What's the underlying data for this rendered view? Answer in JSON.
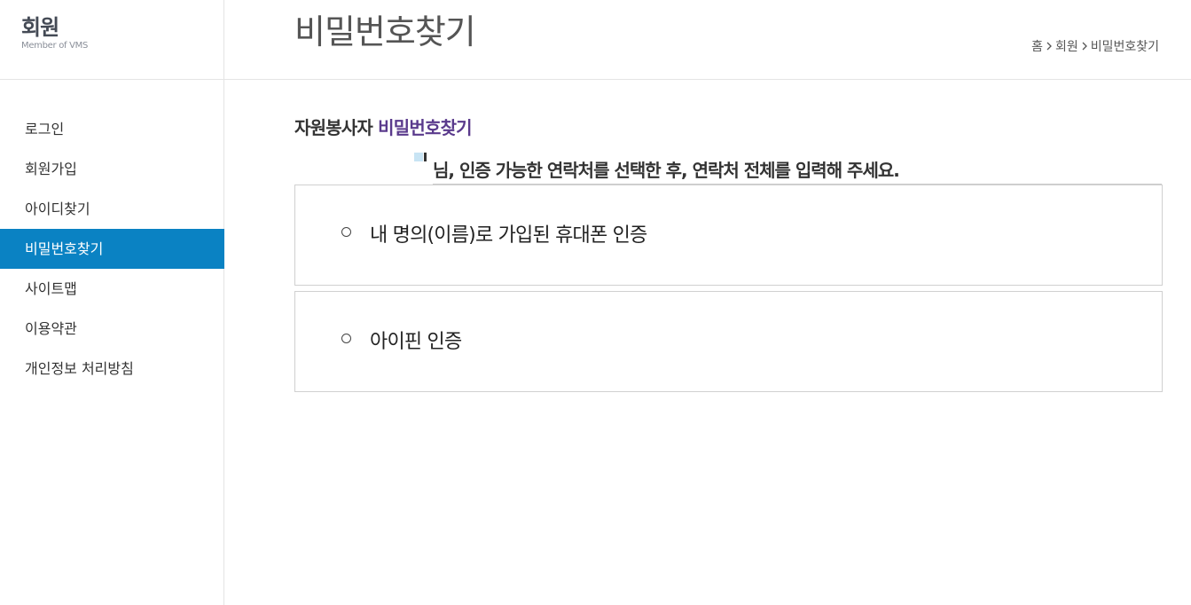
{
  "sidebar": {
    "title": "회원",
    "subtitle": "Member of VMS",
    "items": [
      {
        "label": "로그인",
        "active": false
      },
      {
        "label": "회원가입",
        "active": false
      },
      {
        "label": "아이디찾기",
        "active": false
      },
      {
        "label": "비밀번호찾기",
        "active": true
      },
      {
        "label": "사이트맵",
        "active": false
      },
      {
        "label": "이용약관",
        "active": false
      },
      {
        "label": "개인정보 처리방침",
        "active": false
      }
    ]
  },
  "header": {
    "title": "비밀번호찾기",
    "breadcrumb": [
      "홈",
      "회원",
      "비밀번호찾기"
    ]
  },
  "main": {
    "section_prefix": "자원봉사자 ",
    "section_accent": "비밀번호찾기",
    "instruction": "님, 인증 가능한 연락처를 선택한 후, 연락처 전체를 입력해 주세요.",
    "options": [
      {
        "label": "내 명의(이름)로 가입된 휴대폰 인증",
        "selected": false
      },
      {
        "label": "아이핀 인증",
        "selected": false
      }
    ]
  },
  "colors": {
    "active_nav": "#0a82c3",
    "accent_text": "#5a3a8c"
  },
  "icons": {
    "breadcrumb_separator": "chevron-right-icon",
    "option_radio": "radio-empty-icon"
  }
}
